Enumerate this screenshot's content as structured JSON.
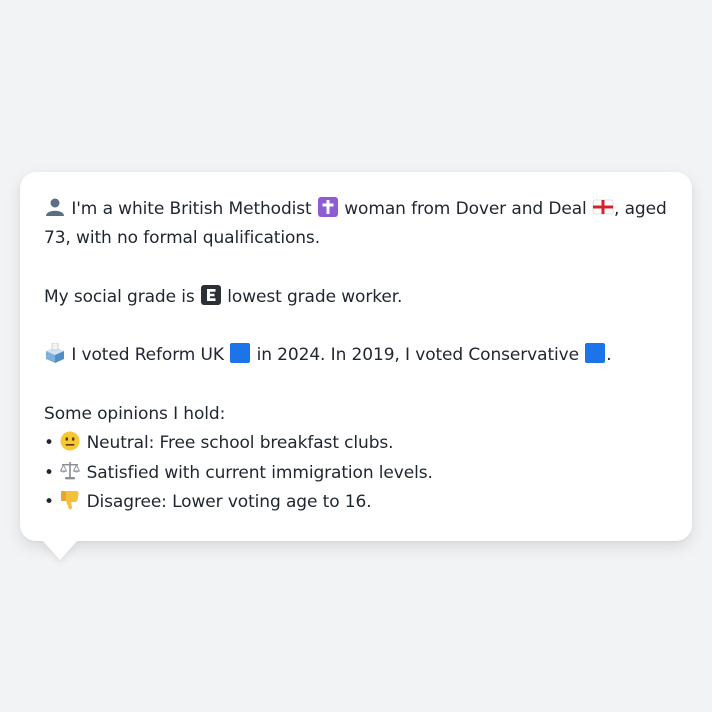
{
  "profile": {
    "line1_a": "I'm a white British Methodist",
    "line1_b": "woman from Dover and Deal",
    "line1_c": ", aged 73, with no formal qualifications.",
    "grade_a": "My social grade is",
    "grade_b": "lowest grade worker.",
    "vote_a": "I voted Reform UK",
    "vote_b": "in 2024. In 2019, I voted Conservative",
    "vote_c": ".",
    "opinions_heading": "Some opinions I hold:",
    "opinions": [
      {
        "bullet": "•",
        "text": "Neutral: Free school breakfast clubs.",
        "icon": "neutral-face-icon"
      },
      {
        "bullet": "•",
        "text": "Satisfied with current immigration levels.",
        "icon": "balance-scale-icon"
      },
      {
        "bullet": "•",
        "text": "Disagree: Lower voting age to 16.",
        "icon": "thumbs-down-icon"
      }
    ]
  },
  "icons": {
    "person": "person-silhouette-icon",
    "religion": "latin-cross-icon",
    "region": "england-flag-icon",
    "grade": "letter-e-icon",
    "ballot": "ballot-box-icon",
    "reform_party": "blue-square-icon",
    "conservative_party": "blue-square-icon"
  },
  "colors": {
    "background": "#f2f3f5",
    "bubble": "#ffffff",
    "text": "#1f2630",
    "party_blue": "#1d73e8",
    "cross_purple": "#8e5bd1"
  }
}
